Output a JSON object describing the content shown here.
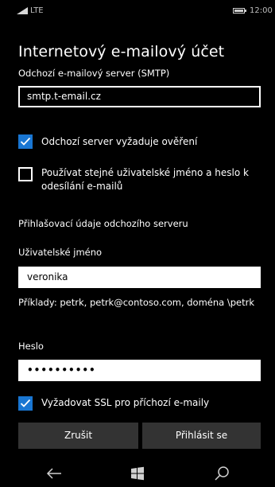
{
  "status": {
    "network": "LTE",
    "time": "12:00"
  },
  "title": "Internetový e-mailový účet",
  "smtp_label": "Odchozí e-mailový server (SMTP)",
  "smtp_value": "smtp.t-email.cz",
  "auth_required": {
    "label": "Odchozí server vyžaduje ověření",
    "checked": true
  },
  "same_credentials": {
    "label": "Používat stejné uživatelské jméno a heslo k odesílání e-mailů",
    "checked": false
  },
  "credentials_header": "Přihlašovací údaje odchozího serveru",
  "username_label": "Uživatelské jméno",
  "username_value": "veronika",
  "username_hint": "Příklady: petrk, petrk@contoso.com, doména \\petrk",
  "password_label": "Heslo",
  "password_value": "••••••••••",
  "ssl_required": {
    "label": "Vyžadovat SSL pro příchozí e-maily",
    "checked": true
  },
  "buttons": {
    "cancel": "Zrušit",
    "login": "Přihlásit se"
  },
  "icons": {
    "back": "back-arrow-icon",
    "start": "windows-logo-icon",
    "search": "search-icon"
  },
  "colors": {
    "accent": "#1976d2",
    "background": "#000000",
    "button": "#333333"
  }
}
